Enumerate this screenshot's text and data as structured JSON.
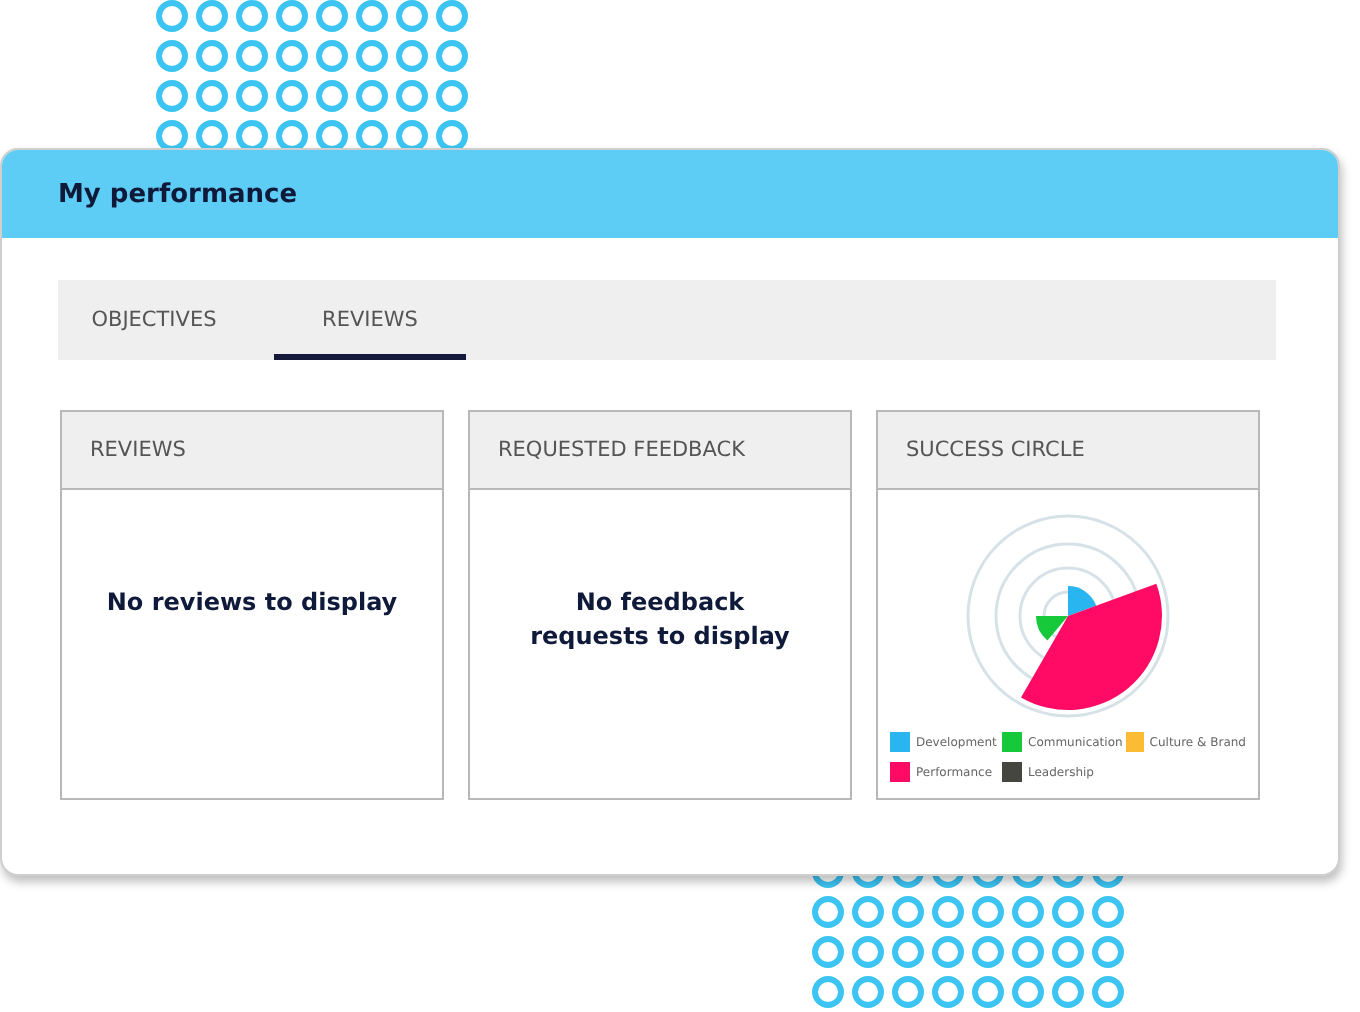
{
  "window": {
    "title": "My performance"
  },
  "tabs": [
    {
      "label": "OBJECTIVES",
      "selected": false
    },
    {
      "label": "REVIEWS",
      "selected": true
    }
  ],
  "panels": [
    {
      "kind": "message",
      "title": "REVIEWS",
      "message": "No reviews to display"
    },
    {
      "kind": "message",
      "title": "REQUESTED FEEDBACK",
      "message": "No feedback requests to display"
    },
    {
      "kind": "chart",
      "title": "SUCCESS CIRCLE",
      "legend": [
        {
          "label": "Development",
          "color": "#29b6f0"
        },
        {
          "label": "Communication",
          "color": "#16c93a"
        },
        {
          "label": "Culture & Brand",
          "color": "#fbbb33"
        },
        {
          "label": "Performance",
          "color": "#ff0a64"
        },
        {
          "label": "Leadership",
          "color": "#45463f"
        }
      ]
    }
  ]
}
